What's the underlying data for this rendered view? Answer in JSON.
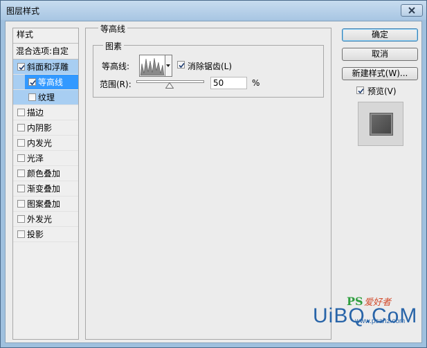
{
  "window": {
    "title": "图层样式"
  },
  "sidebar": {
    "header": "样式",
    "blend_options": "混合选项:自定",
    "items": [
      {
        "label": "斜面和浮雕",
        "checked": true
      },
      {
        "label": "等高线",
        "checked": true
      },
      {
        "label": "纹理",
        "checked": false
      },
      {
        "label": "描边",
        "checked": false
      },
      {
        "label": "内阴影",
        "checked": false
      },
      {
        "label": "内发光",
        "checked": false
      },
      {
        "label": "光泽",
        "checked": false
      },
      {
        "label": "颜色叠加",
        "checked": false
      },
      {
        "label": "渐变叠加",
        "checked": false
      },
      {
        "label": "图案叠加",
        "checked": false
      },
      {
        "label": "外发光",
        "checked": false
      },
      {
        "label": "投影",
        "checked": false
      }
    ]
  },
  "contour_panel": {
    "group_title": "等高线",
    "elements_title": "图素",
    "contour_label": "等高线:",
    "anti_alias_label": "消除锯齿(L)",
    "anti_alias_checked": true,
    "range_label": "范围(R):",
    "range_value": "50",
    "range_unit": "%"
  },
  "buttons": {
    "ok": "确定",
    "cancel": "取消",
    "new_style": "新建样式(W)..."
  },
  "preview": {
    "label": "预览(V)",
    "checked": true
  },
  "watermark": {
    "brand_ps": "PS",
    "brand_cn": "爱好者",
    "big": "UiBQ.CoM",
    "small": "www.psahz.com"
  },
  "colors": {
    "title_bar": "#a8c6e3",
    "selection": "#3399ff",
    "selection_light": "#a8cef2",
    "watermark_blue": "#2864a8"
  }
}
